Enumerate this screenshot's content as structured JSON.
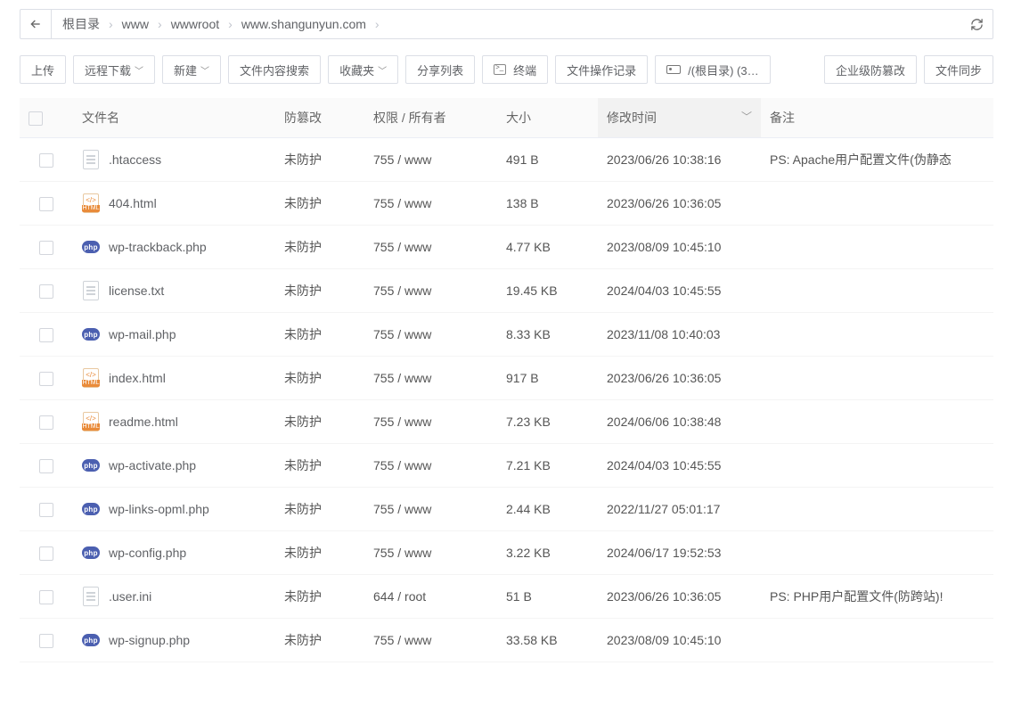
{
  "breadcrumb": {
    "segments": [
      "根目录",
      "www",
      "wwwroot",
      "www.shangunyun.com"
    ]
  },
  "toolbar": {
    "upload": "上传",
    "remote_download": "远程下载",
    "new": "新建",
    "content_search": "文件内容搜索",
    "favorites": "收藏夹",
    "share_list": "分享列表",
    "terminal": "终端",
    "op_log": "文件操作记录",
    "disk_root": "/(根目录) (3…",
    "tamper_protect": "企业级防篡改",
    "sync": "文件同步"
  },
  "columns": {
    "name": "文件名",
    "protect": "防篡改",
    "perm": "权限 / 所有者",
    "size": "大小",
    "modified": "修改时间",
    "note": "备注"
  },
  "rows": [
    {
      "icon": "txt",
      "name": ".htaccess",
      "protect": "未防护",
      "perm": "755 / www",
      "size": "491 B",
      "modified": "2023/06/26 10:38:16",
      "note": "PS: Apache用户配置文件(伪静态"
    },
    {
      "icon": "html",
      "name": "404.html",
      "protect": "未防护",
      "perm": "755 / www",
      "size": "138 B",
      "modified": "2023/06/26 10:36:05",
      "note": ""
    },
    {
      "icon": "php",
      "name": "wp-trackback.php",
      "protect": "未防护",
      "perm": "755 / www",
      "size": "4.77 KB",
      "modified": "2023/08/09 10:45:10",
      "note": ""
    },
    {
      "icon": "txt",
      "name": "license.txt",
      "protect": "未防护",
      "perm": "755 / www",
      "size": "19.45 KB",
      "modified": "2024/04/03 10:45:55",
      "note": ""
    },
    {
      "icon": "php",
      "name": "wp-mail.php",
      "protect": "未防护",
      "perm": "755 / www",
      "size": "8.33 KB",
      "modified": "2023/11/08 10:40:03",
      "note": ""
    },
    {
      "icon": "html",
      "name": "index.html",
      "protect": "未防护",
      "perm": "755 / www",
      "size": "917 B",
      "modified": "2023/06/26 10:36:05",
      "note": ""
    },
    {
      "icon": "html",
      "name": "readme.html",
      "protect": "未防护",
      "perm": "755 / www",
      "size": "7.23 KB",
      "modified": "2024/06/06 10:38:48",
      "note": ""
    },
    {
      "icon": "php",
      "name": "wp-activate.php",
      "protect": "未防护",
      "perm": "755 / www",
      "size": "7.21 KB",
      "modified": "2024/04/03 10:45:55",
      "note": ""
    },
    {
      "icon": "php",
      "name": "wp-links-opml.php",
      "protect": "未防护",
      "perm": "755 / www",
      "size": "2.44 KB",
      "modified": "2022/11/27 05:01:17",
      "note": ""
    },
    {
      "icon": "php",
      "name": "wp-config.php",
      "protect": "未防护",
      "perm": "755 / www",
      "size": "3.22 KB",
      "modified": "2024/06/17 19:52:53",
      "note": ""
    },
    {
      "icon": "txt",
      "name": ".user.ini",
      "protect": "未防护",
      "perm": "644 / root",
      "size": "51 B",
      "modified": "2023/06/26 10:36:05",
      "note": "PS: PHP用户配置文件(防跨站)!"
    },
    {
      "icon": "php",
      "name": "wp-signup.php",
      "protect": "未防护",
      "perm": "755 / www",
      "size": "33.58 KB",
      "modified": "2023/08/09 10:45:10",
      "note": ""
    }
  ]
}
